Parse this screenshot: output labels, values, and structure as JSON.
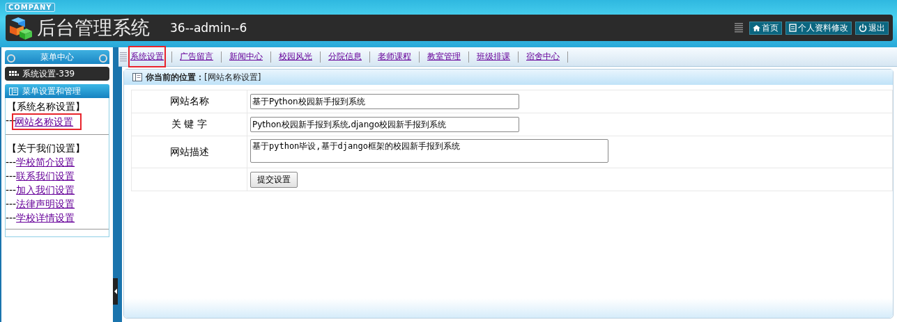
{
  "header": {
    "badge": "COMPANY",
    "title": "后台管理系统",
    "user": "36--admin--6",
    "buttons": [
      {
        "kind": "home",
        "label": "首页"
      },
      {
        "kind": "profile",
        "label": "个人资料修改"
      },
      {
        "kind": "logout",
        "label": "退出"
      }
    ]
  },
  "sidebar": {
    "title": "菜单中心",
    "module": "系统设置-339",
    "panel_title": "菜单设置和管理",
    "groups": [
      {
        "title": "【系统名称设置】",
        "items": [
          {
            "prefix": "---",
            "label": "网站名称设置",
            "highlighted": true
          }
        ]
      },
      {
        "title": "【关于我们设置】",
        "items": [
          {
            "prefix": "---",
            "label": "学校简介设置",
            "highlighted": false
          },
          {
            "prefix": "---",
            "label": "联系我们设置",
            "highlighted": false
          },
          {
            "prefix": "---",
            "label": "加入我们设置",
            "highlighted": false
          },
          {
            "prefix": "---",
            "label": "法律声明设置",
            "highlighted": false
          },
          {
            "prefix": "---",
            "label": "学校详情设置",
            "highlighted": false
          }
        ]
      }
    ]
  },
  "tabs": [
    {
      "label": "系统设置",
      "highlighted": true
    },
    {
      "label": "广告留言",
      "highlighted": false
    },
    {
      "label": "新闻中心",
      "highlighted": false
    },
    {
      "label": "校园风光",
      "highlighted": false
    },
    {
      "label": "分院信息",
      "highlighted": false
    },
    {
      "label": "老师课程",
      "highlighted": false
    },
    {
      "label": "教室管理",
      "highlighted": false
    },
    {
      "label": "班级排课",
      "highlighted": false
    },
    {
      "label": "宿舍中心",
      "highlighted": false
    }
  ],
  "breadcrumb": {
    "label": "你当前的位置：",
    "value": "[网站名称设置]"
  },
  "form": {
    "fields": [
      {
        "kind": "input",
        "label": "网站名称",
        "value": "基于Python校园新手报到系统"
      },
      {
        "kind": "input",
        "label": "关 键 字",
        "value": "Python校园新手报到系统,django校园新手报到系统"
      },
      {
        "kind": "textarea",
        "label": "网站描述",
        "value": "基于python毕设,基于django框架的校园新手报到系统"
      }
    ],
    "submit": "提交设置"
  }
}
